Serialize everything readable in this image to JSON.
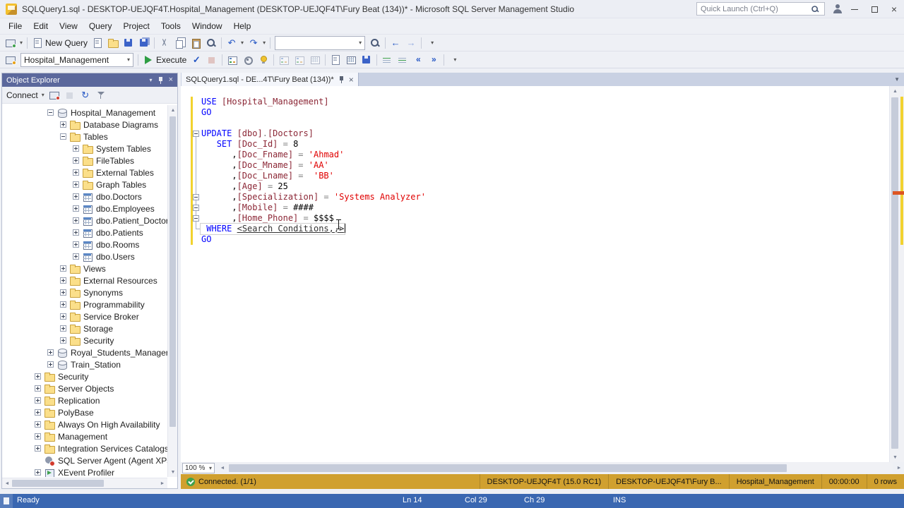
{
  "colors": {
    "keyword": "#0000ff",
    "identifier": "#8b2635",
    "string": "#e00000",
    "operator": "#808080",
    "template_param": "#333333",
    "gold_bar": "#d0a02f",
    "status_bar_blue": "#3a67b1",
    "panel_header": "#5b689c",
    "change_bar": "#f2d22e",
    "execute_green": "#2f9e44",
    "connected_green": "#3fa14d"
  },
  "titlebar": {
    "title": "SQLQuery1.sql - DESKTOP-UEJQF4T.Hospital_Management (DESKTOP-UEJQF4T\\Fury Beat (134))* - Microsoft SQL Server Management Studio",
    "quick_launch_placeholder": "Quick Launch (Ctrl+Q)"
  },
  "menu": {
    "items": [
      "File",
      "Edit",
      "View",
      "Query",
      "Project",
      "Tools",
      "Window",
      "Help"
    ]
  },
  "toolbar_row1": [
    {
      "t": "btn",
      "name": "connect-object-explorer-button",
      "icon": "server",
      "dd": true
    },
    {
      "t": "sep"
    },
    {
      "t": "btn",
      "name": "new-query-button",
      "icon": "page",
      "label": "New Query"
    },
    {
      "t": "btn",
      "name": "new-database-engine-query-button",
      "icon": "page-db"
    },
    {
      "t": "btn",
      "name": "open-file-button",
      "icon": "folder-open"
    },
    {
      "t": "btn",
      "name": "save-button",
      "icon": "save"
    },
    {
      "t": "btn",
      "name": "save-all-button",
      "icon": "save-all"
    },
    {
      "t": "sep"
    },
    {
      "t": "btn",
      "name": "cut-button",
      "icon": "cut"
    },
    {
      "t": "btn",
      "name": "copy-button",
      "icon": "copy"
    },
    {
      "t": "btn",
      "name": "paste-button",
      "icon": "paste"
    },
    {
      "t": "btn",
      "name": "find-button",
      "icon": "find"
    },
    {
      "t": "sep"
    },
    {
      "t": "btn",
      "name": "undo-button",
      "icon": "undo",
      "dd": true
    },
    {
      "t": "btn",
      "name": "redo-button",
      "icon": "redo",
      "dd": true
    },
    {
      "t": "sep"
    },
    {
      "t": "combo",
      "name": "quick-find-combo",
      "value": "",
      "width": 128
    },
    {
      "t": "btn",
      "name": "find-in-files-button",
      "icon": "find"
    },
    {
      "t": "sep"
    },
    {
      "t": "btn",
      "name": "navigate-backward-button",
      "icon": "nav-back"
    },
    {
      "t": "btn",
      "name": "navigate-forward-button",
      "icon": "nav-fwd",
      "enabled": false
    },
    {
      "t": "sep"
    },
    {
      "t": "btn",
      "name": "toolbar-options-button",
      "icon": "dd-only",
      "dd": true
    }
  ],
  "toolbar_row2": [
    {
      "t": "btn",
      "name": "change-connection-button",
      "icon": "plug"
    },
    {
      "t": "combo",
      "name": "available-databases-combo",
      "value": "Hospital_Management",
      "width": 160
    },
    {
      "t": "sep"
    },
    {
      "t": "btn",
      "name": "execute-button",
      "icon": "play",
      "label": "Execute"
    },
    {
      "t": "btn",
      "name": "parse-button",
      "icon": "check"
    },
    {
      "t": "btn",
      "name": "cancel-query-button",
      "icon": "stop-red",
      "enabled": false
    },
    {
      "t": "sep"
    },
    {
      "t": "btn",
      "name": "display-estimated-plan-button",
      "icon": "plan"
    },
    {
      "t": "btn",
      "name": "query-options-button",
      "icon": "options"
    },
    {
      "t": "btn",
      "name": "intellisense-button",
      "icon": "intellisense"
    },
    {
      "t": "sep"
    },
    {
      "t": "btn",
      "name": "include-actual-plan-button",
      "icon": "plan",
      "enabled": false
    },
    {
      "t": "btn",
      "name": "live-query-statistics-button",
      "icon": "plan",
      "enabled": false
    },
    {
      "t": "btn",
      "name": "client-statistics-button",
      "icon": "grid",
      "enabled": false
    },
    {
      "t": "sep"
    },
    {
      "t": "btn",
      "name": "results-to-text-button",
      "icon": "page"
    },
    {
      "t": "btn",
      "name": "results-to-grid-button",
      "icon": "grid"
    },
    {
      "t": "btn",
      "name": "results-to-file-button",
      "icon": "save"
    },
    {
      "t": "sep"
    },
    {
      "t": "btn",
      "name": "comment-lines-button",
      "icon": "comment"
    },
    {
      "t": "btn",
      "name": "uncomment-lines-button",
      "icon": "uncomment"
    },
    {
      "t": "btn",
      "name": "decrease-indent-button",
      "icon": "outdent"
    },
    {
      "t": "btn",
      "name": "increase-indent-button",
      "icon": "indent"
    },
    {
      "t": "sep"
    },
    {
      "t": "btn",
      "name": "toolbar-options-button-2",
      "icon": "dd-only",
      "dd": true
    }
  ],
  "object_explorer": {
    "title": "Object Explorer",
    "toolbar": [
      {
        "t": "btn",
        "name": "connect-menu-button",
        "label": "Connect",
        "dd": true
      },
      {
        "t": "btn",
        "name": "disconnect-button",
        "icon": "server-x"
      },
      {
        "t": "btn",
        "name": "stop-button",
        "icon": "stop",
        "enabled": false
      },
      {
        "t": "btn",
        "name": "refresh-button",
        "icon": "refresh"
      },
      {
        "t": "btn",
        "name": "filter-button",
        "icon": "filter"
      }
    ],
    "tree": [
      {
        "label": "Hospital_Management",
        "level": 2,
        "expand": "minus",
        "icon": "db"
      },
      {
        "label": "Database Diagrams",
        "level": 3,
        "expand": "plus",
        "icon": "folder"
      },
      {
        "label": "Tables",
        "level": 3,
        "expand": "minus",
        "icon": "folder"
      },
      {
        "label": "System Tables",
        "level": 4,
        "expand": "plus",
        "icon": "folder"
      },
      {
        "label": "FileTables",
        "level": 4,
        "expand": "plus",
        "icon": "folder"
      },
      {
        "label": "External Tables",
        "level": 4,
        "expand": "plus",
        "icon": "folder"
      },
      {
        "label": "Graph Tables",
        "level": 4,
        "expand": "plus",
        "icon": "folder"
      },
      {
        "label": "dbo.Doctors",
        "level": 4,
        "expand": "plus",
        "icon": "table"
      },
      {
        "label": "dbo.Employees",
        "level": 4,
        "expand": "plus",
        "icon": "table"
      },
      {
        "label": "dbo.Patient_Doctor",
        "level": 4,
        "expand": "plus",
        "icon": "table"
      },
      {
        "label": "dbo.Patients",
        "level": 4,
        "expand": "plus",
        "icon": "table"
      },
      {
        "label": "dbo.Rooms",
        "level": 4,
        "expand": "plus",
        "icon": "table"
      },
      {
        "label": "dbo.Users",
        "level": 4,
        "expand": "plus",
        "icon": "table"
      },
      {
        "label": "Views",
        "level": 3,
        "expand": "plus",
        "icon": "folder"
      },
      {
        "label": "External Resources",
        "level": 3,
        "expand": "plus",
        "icon": "folder"
      },
      {
        "label": "Synonyms",
        "level": 3,
        "expand": "plus",
        "icon": "folder"
      },
      {
        "label": "Programmability",
        "level": 3,
        "expand": "plus",
        "icon": "folder"
      },
      {
        "label": "Service Broker",
        "level": 3,
        "expand": "plus",
        "icon": "folder"
      },
      {
        "label": "Storage",
        "level": 3,
        "expand": "plus",
        "icon": "folder"
      },
      {
        "label": "Security",
        "level": 3,
        "expand": "plus",
        "icon": "folder"
      },
      {
        "label": "Royal_Students_Manager",
        "level": 2,
        "expand": "plus",
        "icon": "db"
      },
      {
        "label": "Train_Station",
        "level": 2,
        "expand": "plus",
        "icon": "db"
      },
      {
        "label": "Security",
        "level": 1,
        "expand": "plus",
        "icon": "folder"
      },
      {
        "label": "Server Objects",
        "level": 1,
        "expand": "plus",
        "icon": "folder"
      },
      {
        "label": "Replication",
        "level": 1,
        "expand": "plus",
        "icon": "folder"
      },
      {
        "label": "PolyBase",
        "level": 1,
        "expand": "plus",
        "icon": "folder"
      },
      {
        "label": "Always On High Availability",
        "level": 1,
        "expand": "plus",
        "icon": "folder"
      },
      {
        "label": "Management",
        "level": 1,
        "expand": "plus",
        "icon": "folder"
      },
      {
        "label": "Integration Services Catalogs",
        "level": 1,
        "expand": "plus",
        "icon": "folder"
      },
      {
        "label": "SQL Server Agent (Agent XPs dis...",
        "level": 1,
        "expand": null,
        "icon": "agent"
      },
      {
        "label": "XEvent Profiler",
        "level": 1,
        "expand": "plus",
        "icon": "profiler"
      }
    ]
  },
  "editor": {
    "tab_title": "SQLQuery1.sql - DE...4T\\Fury Beat (134))*",
    "zoom": "100 %",
    "caret_line": 13,
    "collapse_boxes": [
      4,
      10,
      11,
      12
    ],
    "lines": [
      [
        [
          "k",
          "USE "
        ],
        [
          "i",
          "[Hospital_Management]"
        ]
      ],
      [
        [
          "k",
          "GO"
        ]
      ],
      [],
      [
        [
          "k",
          "UPDATE "
        ],
        [
          "i",
          "[dbo]"
        ],
        [
          "o",
          "."
        ],
        [
          "i",
          "[Doctors]"
        ]
      ],
      [
        [
          "p",
          "   "
        ],
        [
          "k",
          "SET "
        ],
        [
          "i",
          "[Doc_Id]"
        ],
        [
          "p",
          " "
        ],
        [
          "o",
          "="
        ],
        [
          "p",
          " 8"
        ]
      ],
      [
        [
          "p",
          "      ,"
        ],
        [
          "i",
          "[Doc_Fname]"
        ],
        [
          "p",
          " "
        ],
        [
          "o",
          "="
        ],
        [
          "p",
          " "
        ],
        [
          "s",
          "'Ahmad'"
        ]
      ],
      [
        [
          "p",
          "      ,"
        ],
        [
          "i",
          "[Doc_Mname]"
        ],
        [
          "p",
          " "
        ],
        [
          "o",
          "="
        ],
        [
          "p",
          " "
        ],
        [
          "s",
          "'AA'"
        ]
      ],
      [
        [
          "p",
          "      ,"
        ],
        [
          "i",
          "[Doc_Lname]"
        ],
        [
          "p",
          " "
        ],
        [
          "o",
          "="
        ],
        [
          "p",
          "  "
        ],
        [
          "s",
          "'BB'"
        ]
      ],
      [
        [
          "p",
          "      ,"
        ],
        [
          "i",
          "[Age]"
        ],
        [
          "p",
          " "
        ],
        [
          "o",
          "="
        ],
        [
          "p",
          " 25"
        ]
      ],
      [
        [
          "p",
          "      ,"
        ],
        [
          "i",
          "[Specialization]"
        ],
        [
          "p",
          " "
        ],
        [
          "o",
          "="
        ],
        [
          "p",
          " "
        ],
        [
          "s",
          "'Systems Analyzer'"
        ]
      ],
      [
        [
          "p",
          "      ,"
        ],
        [
          "i",
          "[Mobile]"
        ],
        [
          "p",
          " "
        ],
        [
          "o",
          "="
        ],
        [
          "p",
          " ####"
        ]
      ],
      [
        [
          "p",
          "      ,"
        ],
        [
          "i",
          "[Home_Phone]"
        ],
        [
          "p",
          " "
        ],
        [
          "o",
          "="
        ],
        [
          "p",
          " $$$$"
        ]
      ],
      [
        [
          "p",
          " "
        ],
        [
          "k",
          "WHERE "
        ],
        [
          "t",
          "<Search Conditions,,>"
        ]
      ],
      [
        [
          "k",
          "GO"
        ]
      ]
    ]
  },
  "query_status": {
    "connected": "Connected. (1/1)",
    "server": "DESKTOP-UEJQF4T (15.0 RC1)",
    "login": "DESKTOP-UEJQF4T\\Fury B...",
    "database": "Hospital_Management",
    "duration": "00:00:00",
    "rows": "0 rows"
  },
  "status_bar": {
    "ready": "Ready",
    "line": "Ln 14",
    "column": "Col 29",
    "character": "Ch 29",
    "mode": "INS"
  }
}
